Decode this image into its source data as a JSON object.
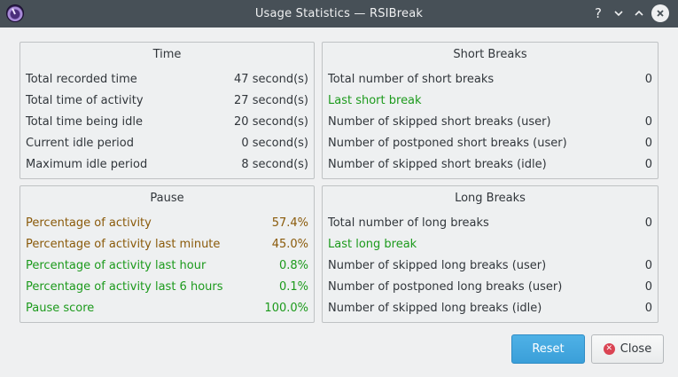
{
  "window": {
    "title": "Usage Statistics — RSIBreak",
    "help": "?",
    "minimize": "⌄",
    "maximize": "⌃",
    "close": "✕"
  },
  "time": {
    "title": "Time",
    "rows": [
      {
        "label": "Total recorded time",
        "value": "47 second(s)"
      },
      {
        "label": "Total time of activity",
        "value": "27 second(s)"
      },
      {
        "label": "Total time being idle",
        "value": "20 second(s)"
      },
      {
        "label": "Current idle period",
        "value": "0 second(s)"
      },
      {
        "label": "Maximum idle period",
        "value": "8 second(s)"
      }
    ]
  },
  "short_breaks": {
    "title": "Short Breaks",
    "rows": [
      {
        "label": "Total number of short breaks",
        "value": "0"
      },
      {
        "label": "Last short break",
        "value": ""
      },
      {
        "label": "Number of skipped short breaks (user)",
        "value": "0"
      },
      {
        "label": "Number of postponed short breaks (user)",
        "value": "0"
      },
      {
        "label": "Number of skipped short breaks (idle)",
        "value": "0"
      }
    ]
  },
  "pause": {
    "title": "Pause",
    "rows": [
      {
        "label": "Percentage of activity",
        "value": "57.4%"
      },
      {
        "label": "Percentage of activity last minute",
        "value": "45.0%"
      },
      {
        "label": "Percentage of activity last hour",
        "value": "0.8%"
      },
      {
        "label": "Percentage of activity last 6 hours",
        "value": "0.1%"
      },
      {
        "label": "Pause score",
        "value": "100.0%"
      }
    ]
  },
  "long_breaks": {
    "title": "Long Breaks",
    "rows": [
      {
        "label": "Total number of long breaks",
        "value": "0"
      },
      {
        "label": "Last long break",
        "value": ""
      },
      {
        "label": "Number of skipped long breaks (user)",
        "value": "0"
      },
      {
        "label": "Number of postponed long breaks (user)",
        "value": "0"
      },
      {
        "label": "Number of skipped long breaks (idle)",
        "value": "0"
      }
    ]
  },
  "buttons": {
    "reset": "Reset",
    "close": "Close"
  },
  "colors": {
    "accent": "#3daee9",
    "warning_text": "#8a5a0a",
    "good_text": "#1c9a1c",
    "titlebar": "#475057"
  },
  "icons": {
    "app": "rsibreak-app-icon",
    "help": "help-icon",
    "minimize": "minimize-icon",
    "maximize": "maximize-icon",
    "close": "close-icon",
    "close_button": "dialog-close-icon"
  }
}
